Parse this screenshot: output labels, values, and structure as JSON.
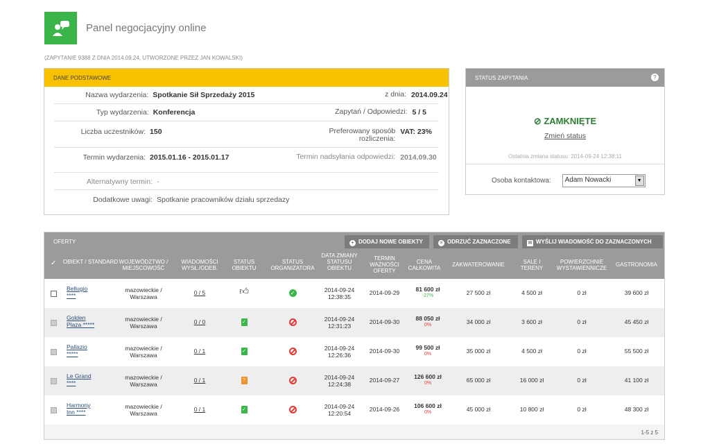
{
  "app": {
    "title": "Panel negocjacyjny online",
    "subinfo": "(ZAPYTANIE 9388 Z DNIA 2014.09.24, UTWORZONE PRZEZ JAN KOWALSKI)"
  },
  "basic": {
    "header": "DANE PODSTAWOWE",
    "event_name_label": "Nazwa wydarzenia:",
    "event_name": "Spotkanie Sił Sprzedaży 2015",
    "date_label": "z dnia:",
    "date": "2014.09.24",
    "event_type_label": "Typ wydarzenia:",
    "event_type": "Konferencja",
    "queries_label": "Zapytań / Odpowiedzi:",
    "queries": "5 / 5",
    "participants_label": "Liczba uczestników:",
    "participants": "150",
    "settlement_label": "Preferowany sposób rozliczenia:",
    "settlement": "VAT: 23%",
    "term_label": "Termin wydarzenia:",
    "term": "2015.01.16 - 2015.01.17",
    "deadline_label": "Termin nadsyłania odpowiedzi:",
    "deadline": "2014.09.30",
    "alt_label": "Alternatywny termin:",
    "alt": "-",
    "notes_label": "Dodatkowe uwagi:",
    "notes": "Spotkanie pracowników działu sprzedazy"
  },
  "status": {
    "header": "STATUS ZAPYTANIA",
    "help": "?",
    "value": "ZAMKNIĘTE",
    "change": "Zmień status",
    "last_change": "Ostatnia zmiana statusu: 2014-09-24 12:38:11",
    "contact_label": "Osoba kontaktowa:",
    "contact": "Adam Nowacki"
  },
  "offers": {
    "header": "OFERTY",
    "add": "DODAJ NOWE OBIEKTY",
    "reject": "ODRZUĆ ZAZNACZONE",
    "message": "WYŚLIJ WIADOMOŚĆ DO ZAZNACZONYCH",
    "columns": [
      "OBIEKT / STANDARD",
      "WOJEWÓDZTWO / MIEJSCOWOŚĆ",
      "WIADOMOŚCI WYSŁ./ODEB.",
      "STATUS OBIEKTU",
      "STATUS ORGANIZATORA",
      "DATA ZMIANY STATUSU OBIEKTU",
      "TERMIN WAŻNOŚCI OFERTY",
      "CENA CAŁKOWITA",
      "ZAKWATEROWANIE",
      "SALE I TERENY",
      "POWIERZCHNIE WYSTAWIENNICZE",
      "GASTRONOMIA"
    ],
    "rows": [
      {
        "name1": "Bellugio",
        "name2": "****",
        "region": "mazowieckie /",
        "city": "Warszawa",
        "msgs": "0 / 5",
        "date": "2014-09-24",
        "time": "12:38:35",
        "valid": "2014-09-29",
        "price": "81 600 zł",
        "pct": "-27%",
        "acc": "27 500 zł",
        "halls": "4 500 zł",
        "exh": "0 zł",
        "gastro": "39 600 zł"
      },
      {
        "name1": "Golden",
        "name2": "Plaza *****",
        "region": "mazowieckie /",
        "city": "Warszawa",
        "msgs": "0 / 0",
        "date": "2014-09-24",
        "time": "12:31:23",
        "valid": "2014-09-30",
        "price": "88 050 zł",
        "pct": "0%",
        "acc": "34 000 zł",
        "halls": "3 600 zł",
        "exh": "0 zł",
        "gastro": "45 450 zł"
      },
      {
        "name1": "Pallazio",
        "name2": "*****",
        "region": "mazowieckie /",
        "city": "Warszawa",
        "msgs": "0 / 1",
        "date": "2014-09-24",
        "time": "12:26:36",
        "valid": "2014-09-30",
        "price": "99 500 zł",
        "pct": "0%",
        "acc": "35 000 zł",
        "halls": "4 500 zł",
        "exh": "0 zł",
        "gastro": "55 500 zł"
      },
      {
        "name1": "Le Grand",
        "name2": "****",
        "region": "mazowieckie /",
        "city": "Warszawa",
        "msgs": "0 / 1",
        "date": "2014-09-24",
        "time": "12:24:38",
        "valid": "2014-09-27",
        "price": "126 600 zł",
        "pct": "0%",
        "acc": "65 000 zł",
        "halls": "16 000 zł",
        "exh": "0 zł",
        "gastro": "41 100 zł"
      },
      {
        "name1": "Harmony",
        "name2": "Inn ****",
        "region": "mazowieckie /",
        "city": "Warszawa",
        "msgs": "0 / 1",
        "date": "2014-09-24",
        "time": "12:20:54",
        "valid": "2014-09-26",
        "price": "106 600 zł",
        "pct": "0%",
        "acc": "45 000 zł",
        "halls": "10 800 zł",
        "exh": "0 zł",
        "gastro": "48 300 zł"
      }
    ],
    "pager": "1-5 z 5"
  }
}
